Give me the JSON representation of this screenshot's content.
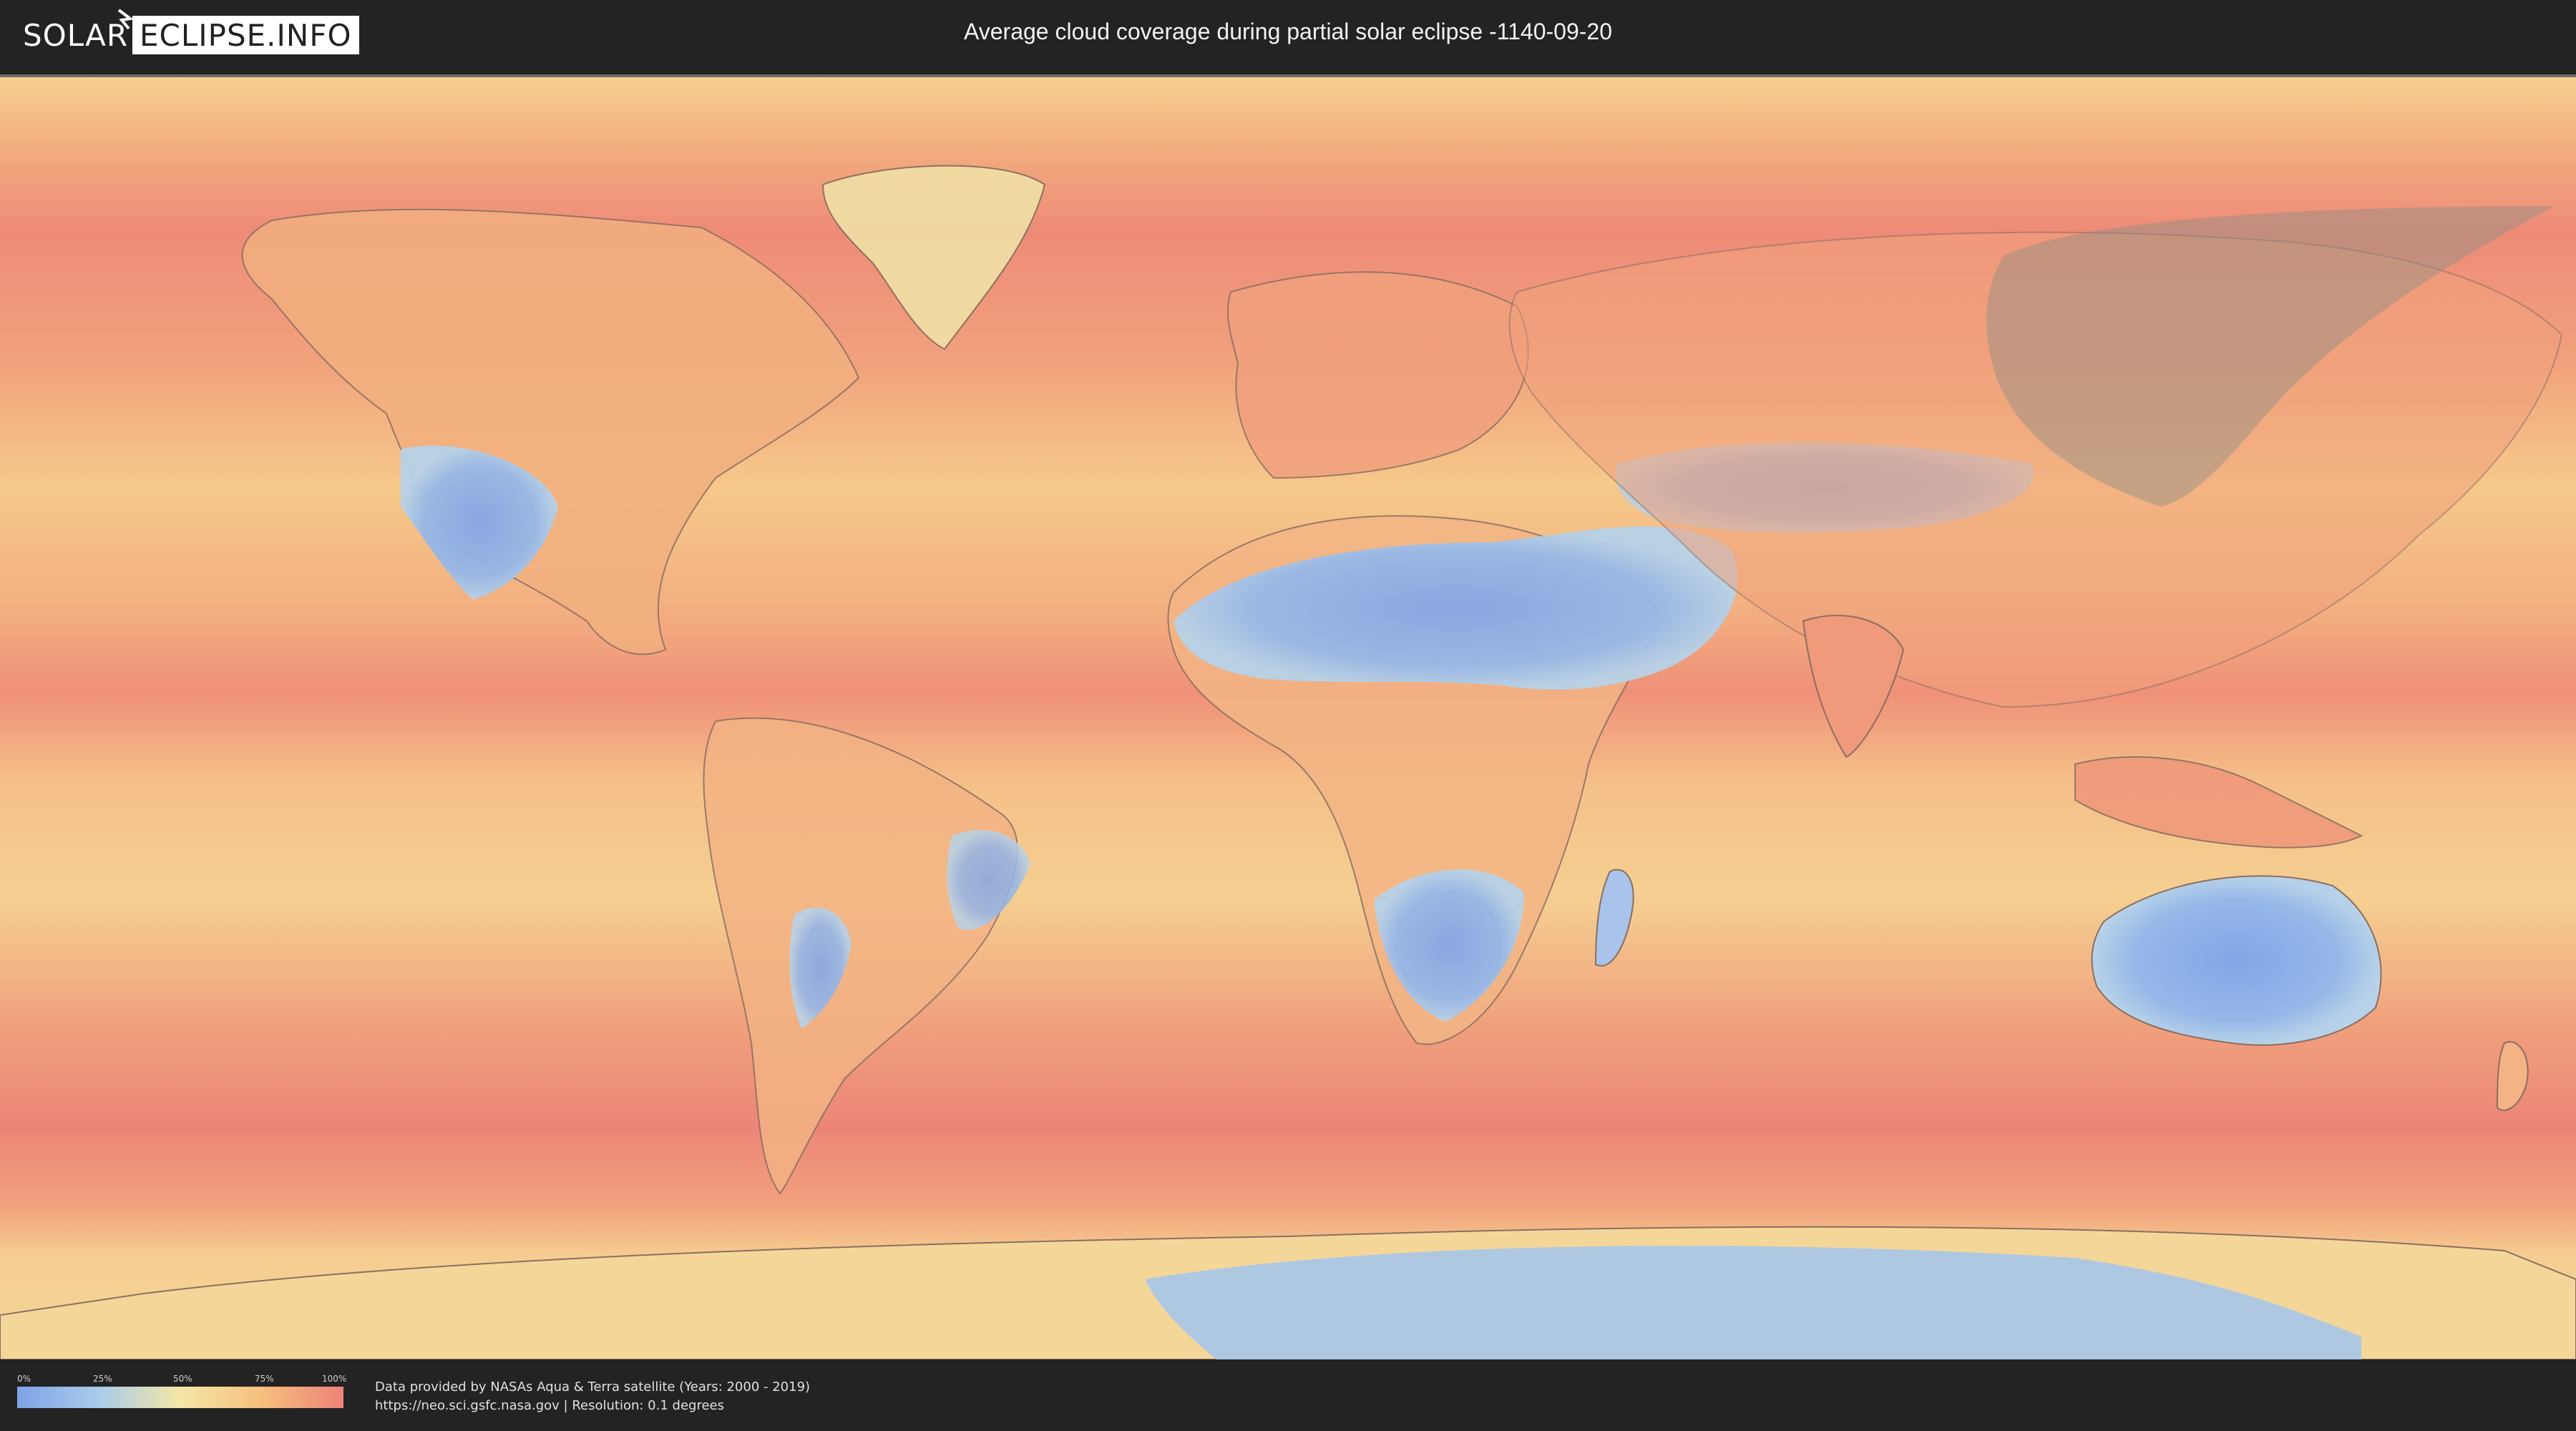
{
  "header": {
    "logo_left": "SOLAR",
    "logo_right": "ECLIPSE.INFO",
    "title": "Average cloud coverage during partial solar eclipse -1140-09-20"
  },
  "map": {
    "description_icon": "world-map-icon",
    "eclipse_shadow_color": "#8f8f86",
    "land_outline_color": "#8a6f62",
    "colors": {
      "low": "#7ea3e6",
      "mid_low": "#a9ccea",
      "mid": "#f4e6a6",
      "mid_high": "#f6bf7d",
      "high": "#ee8278"
    }
  },
  "legend": {
    "ticks": [
      "0%",
      "25%",
      "50%",
      "75%",
      "100%"
    ],
    "tick_values": [
      0,
      25,
      50,
      75,
      100
    ]
  },
  "credits": {
    "line1": "Data provided by NASAs Aqua & Terra satellite (Years: 2000 - 2019)",
    "line2": "https://neo.sci.gsfc.nasa.gov | Resolution: 0.1 degrees"
  }
}
